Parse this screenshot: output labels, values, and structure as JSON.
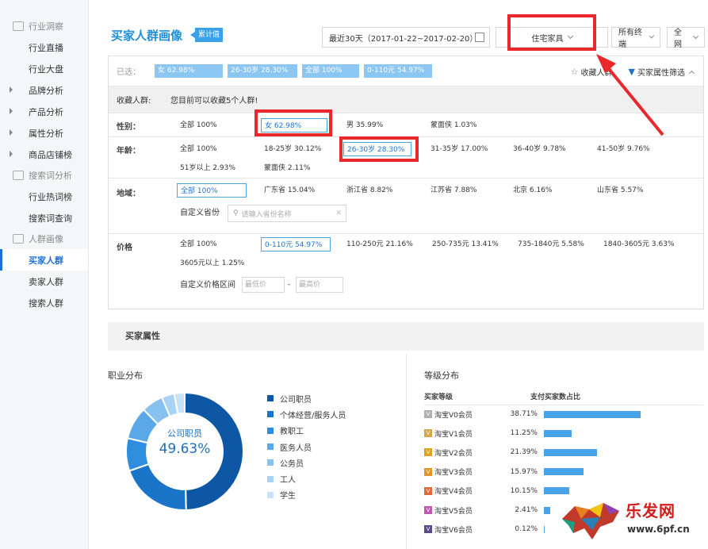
{
  "sidebar": {
    "sections": [
      {
        "label": "行业洞察",
        "items": [
          {
            "label": "行业直播"
          },
          {
            "label": "行业大盘"
          }
        ]
      },
      {
        "label": "",
        "items": [
          {
            "label": "品牌分析"
          },
          {
            "label": "产品分析"
          },
          {
            "label": "属性分析"
          },
          {
            "label": "商品店铺榜"
          }
        ]
      },
      {
        "label": "搜索词分析",
        "items": [
          {
            "label": "行业热词榜"
          },
          {
            "label": "搜索词查询"
          }
        ]
      },
      {
        "label": "人群画像",
        "items": [
          {
            "label": "买家人群"
          },
          {
            "label": "卖家人群"
          },
          {
            "label": "搜索人群"
          }
        ]
      }
    ]
  },
  "header": {
    "title": "买家人群画像",
    "badge": "累计值",
    "date_range": "最近30天（2017-01-22~2017-02-20）",
    "category": "住宅家具",
    "terminal": "所有终端",
    "network": "全网"
  },
  "filter": {
    "selected_label": "已选：",
    "selected_tags": [
      "女 62.98%",
      "26-30岁 28.30%",
      "全部 100%",
      "0-110元 54.97%"
    ],
    "favorite_label": "收藏人群",
    "attr_filter_label": "买家属性筛选",
    "fav_row_label": "收藏人群:",
    "fav_row_hint": "您目前可以收藏5个人群!",
    "gender_label": "性别：",
    "gender_options": [
      "全部  100%",
      "女  62.98%",
      "男  35.99%",
      "蒙面侠  1.03%"
    ],
    "age_label": "年龄：",
    "age_options": [
      "全部  100%",
      "18-25岁  30.12%",
      "26-30岁  28.30%",
      "31-35岁  17.00%",
      "36-40岁  9.78%",
      "41-50岁  9.76%",
      "51岁以上  2.93%",
      "蒙面侠  2.11%"
    ],
    "region_label": "地域：",
    "region_options": [
      "全部  100%",
      "广东省  15.04%",
      "浙江省  8.82%",
      "江苏省  7.88%",
      "北京  6.16%",
      "山东省  5.57%"
    ],
    "custom_province_label": "自定义省份",
    "province_placeholder": "请输入省份名称",
    "price_label": "价格",
    "price_options": [
      "全部  100%",
      "0-110元  54.97%",
      "110-250元  21.16%",
      "250-735元  13.41%",
      "735-1840元  5.58%",
      "1840-3605元  3.63%",
      "3605元以上  1.25%"
    ],
    "custom_price_label": "自定义价格区间",
    "min_price_placeholder": "最低价",
    "max_price_placeholder": "最高价",
    "range_sep": "-"
  },
  "buyer_attr": {
    "title": "买家属性",
    "occupation_title": "职业分布",
    "donut_center_label": "公司职员",
    "donut_center_value": "49.63%",
    "level_title": "等级分布",
    "level_col1": "买家等级",
    "level_col2": "支付买家数占比"
  },
  "occupation_legend": [
    {
      "label": "公司职员",
      "color": "#0d57a4"
    },
    {
      "label": "个体经营/服务人员",
      "color": "#1a74c8"
    },
    {
      "label": "教职工",
      "color": "#2f8ddd"
    },
    {
      "label": "医务人员",
      "color": "#5aa8e8"
    },
    {
      "label": "公务员",
      "color": "#87c1ef"
    },
    {
      "label": "工人",
      "color": "#a9d3f4"
    },
    {
      "label": "学生",
      "color": "#c8e3f8"
    }
  ],
  "chart_data": [
    {
      "type": "pie",
      "categories": [
        "公司职员",
        "个体经营/服务人员",
        "教职工",
        "医务人员",
        "公务员",
        "工人",
        "学生"
      ],
      "values": [
        49.63,
        20.0,
        9.0,
        9.0,
        6.0,
        3.5,
        2.87
      ],
      "title": "职业分布"
    },
    {
      "type": "bar",
      "categories": [
        "淘宝V0会员",
        "淘宝V1会员",
        "淘宝V2会员",
        "淘宝V3会员",
        "淘宝V4会员",
        "淘宝V5会员",
        "淘宝V6会员"
      ],
      "values": [
        38.71,
        11.25,
        21.39,
        15.97,
        10.15,
        2.41,
        0.12
      ],
      "labels": [
        "38.71%",
        "11.25%",
        "21.39%",
        "15.97%",
        "10.15%",
        "2.41%",
        "0.12%"
      ],
      "title": "等级分布",
      "icon_colors": [
        "#b0b0b0",
        "#d6a74a",
        "#e0a020",
        "#e59524",
        "#e26a3a",
        "#c05ab0",
        "#5a4a8a"
      ],
      "bar_color": "#4aa3e8"
    }
  ],
  "watermark": {
    "text": "乐发网",
    "url": "www.6pf.cn"
  }
}
